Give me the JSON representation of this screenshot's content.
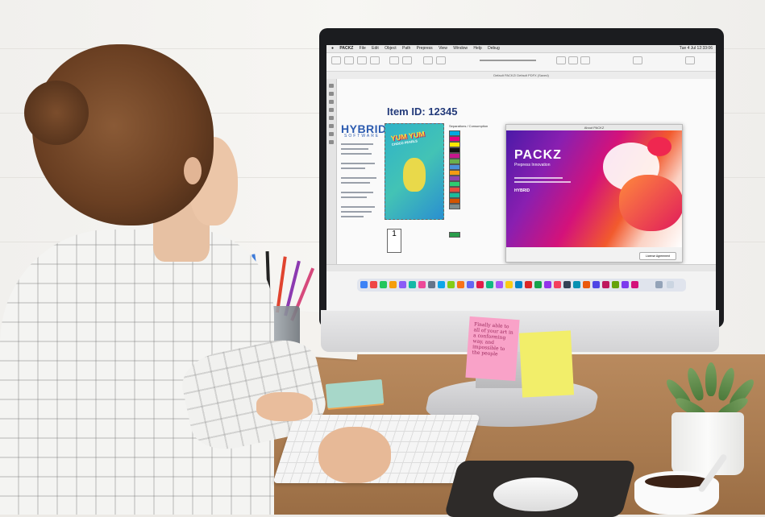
{
  "monitor": {
    "menu_items": [
      "PACKZ",
      "File",
      "Edit",
      "Object",
      "Path",
      "Prepress",
      "View",
      "Window",
      "Help",
      "Debug"
    ],
    "clock": "Tue 4 Jul 12:33:06",
    "document_tab": "Default PACKZ/ Default PDFX (Saved)"
  },
  "artwork": {
    "item_id_label": "Item ID:",
    "item_id_value": "12345",
    "company_logo": "HYBRID",
    "company_sub": "SOFTWARE",
    "product_name": "YUM YUM",
    "product_sub": "CHOCO PEARLS",
    "separations_title": "Separations / Consumption",
    "small_box_value": "1"
  },
  "about_dialog": {
    "window_title": "About PACKZ",
    "product": "PACKZ",
    "tagline": "Prepress Innovation",
    "company_mark": "HYBRID",
    "button": "License Agreement"
  },
  "sticky_note": {
    "text": "Finally able to all of your art in a conforming way, and impossible to the people"
  },
  "colors": {
    "accent_blue": "#2d5cb0",
    "dialog_magenta": "#d4127a",
    "dialog_purple": "#4b1aa8",
    "sticky_pink": "#f9a2c8",
    "sticky_yellow": "#f2ee6a"
  }
}
